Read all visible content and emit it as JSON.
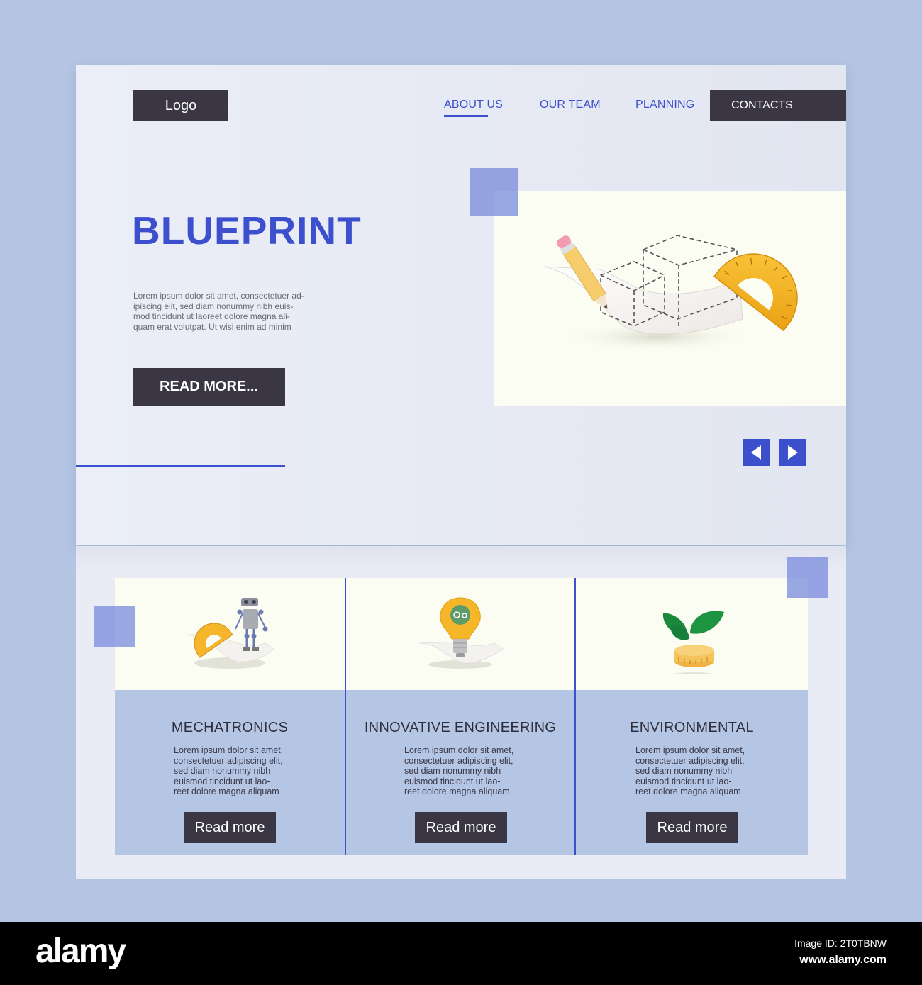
{
  "header": {
    "logo_label": "Logo",
    "nav": [
      {
        "label": "ABOUT US",
        "active": true
      },
      {
        "label": "OUR TEAM",
        "active": false
      },
      {
        "label": "PLANNING",
        "active": false
      }
    ],
    "contacts_label": "CONTACTS"
  },
  "hero": {
    "title": "BLUEPRINT",
    "description_lines": [
      "Lorem ipsum dolor sit amet, consectetuer ad-",
      "ipiscing elit, sed diam nonummy nibh euis-",
      "mod tincidunt ut laoreet dolore magna ali-",
      "quam erat volutpat. Ut wisi enim ad minim"
    ],
    "read_more_label": "READ MORE...",
    "image_icon": "blueprint-illustration",
    "prev_icon": "arrow-left-icon",
    "next_icon": "arrow-right-icon"
  },
  "features": {
    "cards": [
      {
        "title": "MECHATRONICS",
        "icon": "robot-protractor-illustration",
        "description_lines": [
          "Lorem ipsum dolor sit amet,",
          "consectetuer adipiscing elit,",
          "sed diam nonummy nibh",
          "euismod tincidunt ut lao-",
          "reet dolore magna aliquam"
        ],
        "button_label": "Read more"
      },
      {
        "title": "INNOVATIVE ENGINEERING",
        "icon": "lightbulb-gears-illustration",
        "description_lines": [
          "Lorem ipsum dolor sit amet,",
          "consectetuer adipiscing elit,",
          "sed diam nonummy nibh",
          "euismod tincidunt ut lao-",
          "reet dolore magna aliquam"
        ],
        "button_label": "Read more"
      },
      {
        "title": "ENVIRONMENTAL",
        "icon": "sprout-tape-measure-illustration",
        "description_lines": [
          "Lorem ipsum dolor sit amet,",
          "consectetuer adipiscing elit,",
          "sed diam nonummy nibh",
          "euismod tincidunt ut lao-",
          "reet dolore magna aliquam"
        ],
        "button_label": "Read more"
      }
    ]
  },
  "watermark": {
    "brand": "alamy",
    "image_id": "Image ID: 2T0TBNW",
    "url": "www.alamy.com"
  },
  "colors": {
    "accent": "#3c4fcc",
    "dark_button": "#3a3643",
    "page_background": "#b4c5e3",
    "panel_background": "#e9ecf5",
    "image_background": "#fbfdf2",
    "card_bottom": "#b5c6e4",
    "deco_square": "#8d9be0"
  }
}
